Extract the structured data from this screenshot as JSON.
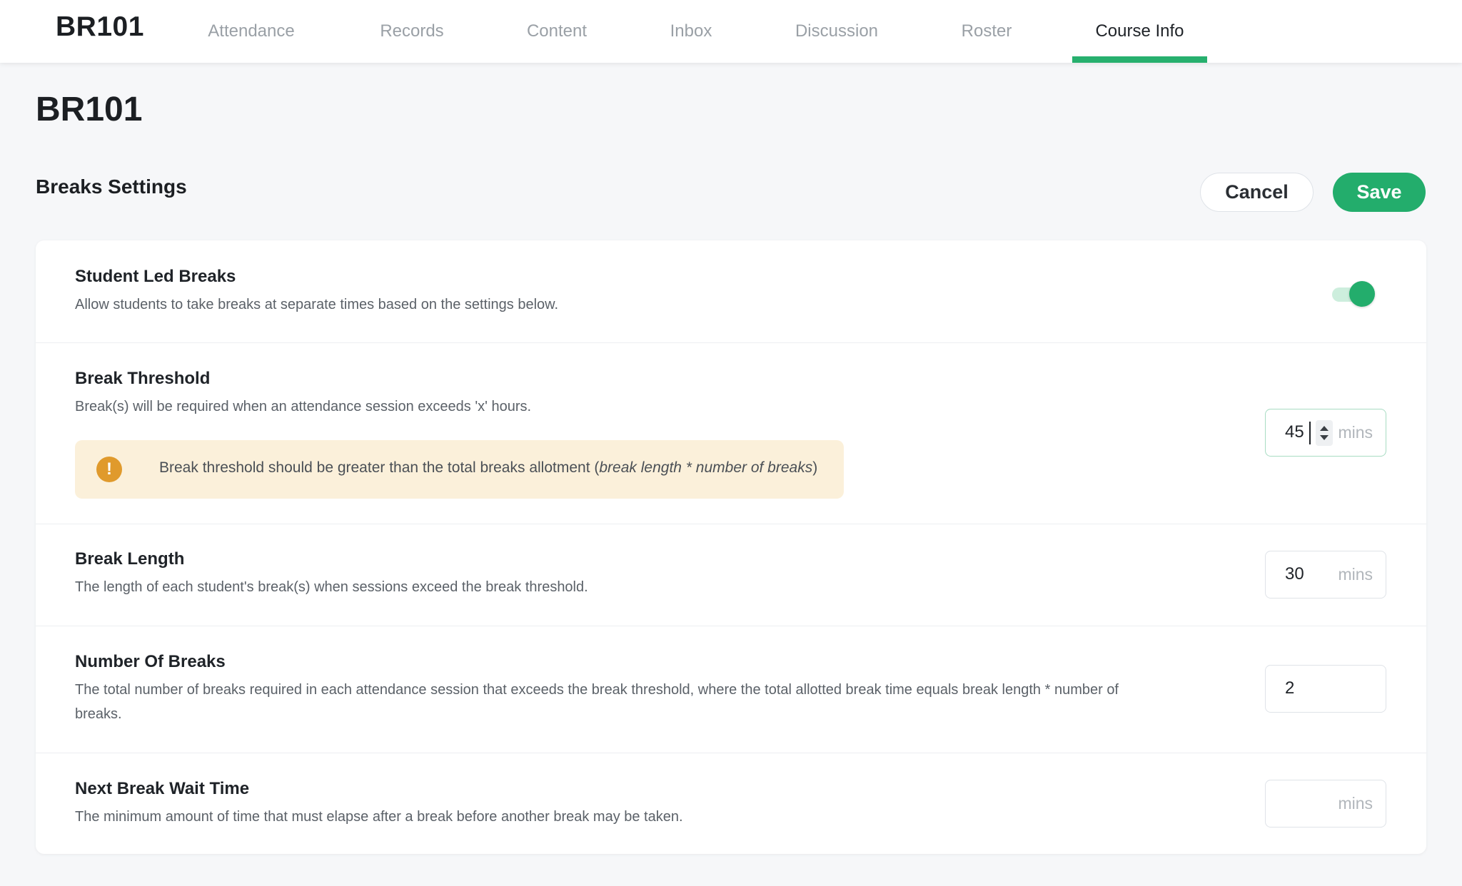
{
  "nav": {
    "brand": "BR101",
    "tabs": [
      {
        "label": "Attendance"
      },
      {
        "label": "Records"
      },
      {
        "label": "Content"
      },
      {
        "label": "Inbox"
      },
      {
        "label": "Discussion"
      },
      {
        "label": "Roster"
      },
      {
        "label": "Course Info",
        "active": true
      }
    ]
  },
  "page": {
    "title": "BR101",
    "section_title": "Breaks Settings",
    "cancel_label": "Cancel",
    "save_label": "Save"
  },
  "settings": {
    "student_led": {
      "title": "Student Led Breaks",
      "description": "Allow students to take breaks at separate times based on the settings below.",
      "enabled": true
    },
    "threshold": {
      "title": "Break Threshold",
      "description": "Break(s) will be required when an attendance session exceeds 'x' hours.",
      "value": "45",
      "unit": "mins",
      "warning_icon": "exclamation-icon",
      "warning_prefix": "Break threshold should be greater than the total breaks allotment (",
      "warning_emphasis": "break length * number of breaks",
      "warning_suffix": ")"
    },
    "length": {
      "title": "Break Length",
      "description": "The length of each student's break(s) when sessions exceed the break threshold.",
      "value": "30",
      "unit": "mins"
    },
    "count": {
      "title": "Number Of Breaks",
      "description_line1": "The total number of breaks required in each attendance session that exceeds the break threshold, where the total allotted break time equals break length * number of",
      "description_line2": "breaks.",
      "value": "2"
    },
    "wait": {
      "title": "Next Break Wait Time",
      "description": "The minimum amount of time that must elapse after a break before another break may be taken.",
      "value": "",
      "unit": "mins"
    }
  },
  "colors": {
    "accent": "#23ad6c",
    "warning_bg": "#fbf0da",
    "warning_icon": "#e09a2c"
  }
}
